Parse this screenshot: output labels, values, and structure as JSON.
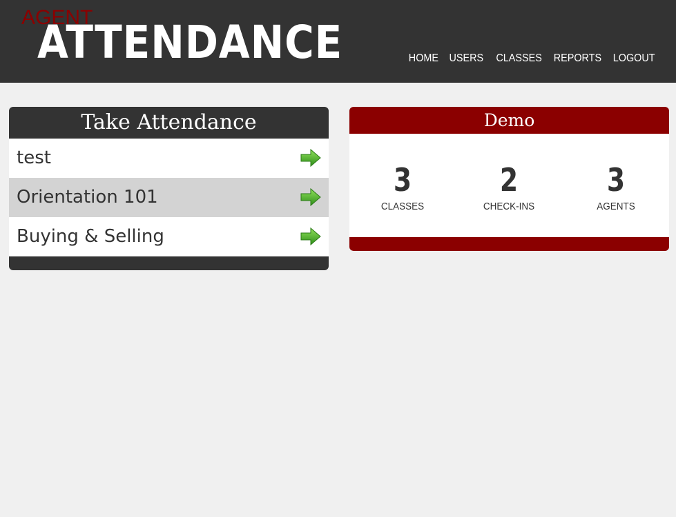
{
  "header": {
    "logo_small": "AGENT",
    "logo_big": "ATTENDANCE",
    "nav": [
      {
        "label": "HOME"
      },
      {
        "label": "USERS"
      },
      {
        "label": "CLASSES"
      },
      {
        "label": "REPORTS"
      },
      {
        "label": "LOGOUT"
      }
    ]
  },
  "attendance_panel": {
    "title": "Take Attendance",
    "classes": [
      {
        "name": "test",
        "icon": "green-arrow-icon"
      },
      {
        "name": "Orientation 101",
        "icon": "green-arrow-icon",
        "highlighted": true
      },
      {
        "name": "Buying & Selling",
        "icon": "green-arrow-icon"
      }
    ]
  },
  "summary_panel": {
    "title": "Demo",
    "stats": [
      {
        "value": "3",
        "label": "CLASSES"
      },
      {
        "value": "2",
        "label": "CHECK-INS"
      },
      {
        "value": "3",
        "label": "AGENTS"
      }
    ]
  },
  "colors": {
    "header_bg": "#333333",
    "accent": "#8b0000",
    "page_bg": "#f0f0f0",
    "row_highlight": "#d3d3d3",
    "arrow_green": "#4caf2a"
  }
}
